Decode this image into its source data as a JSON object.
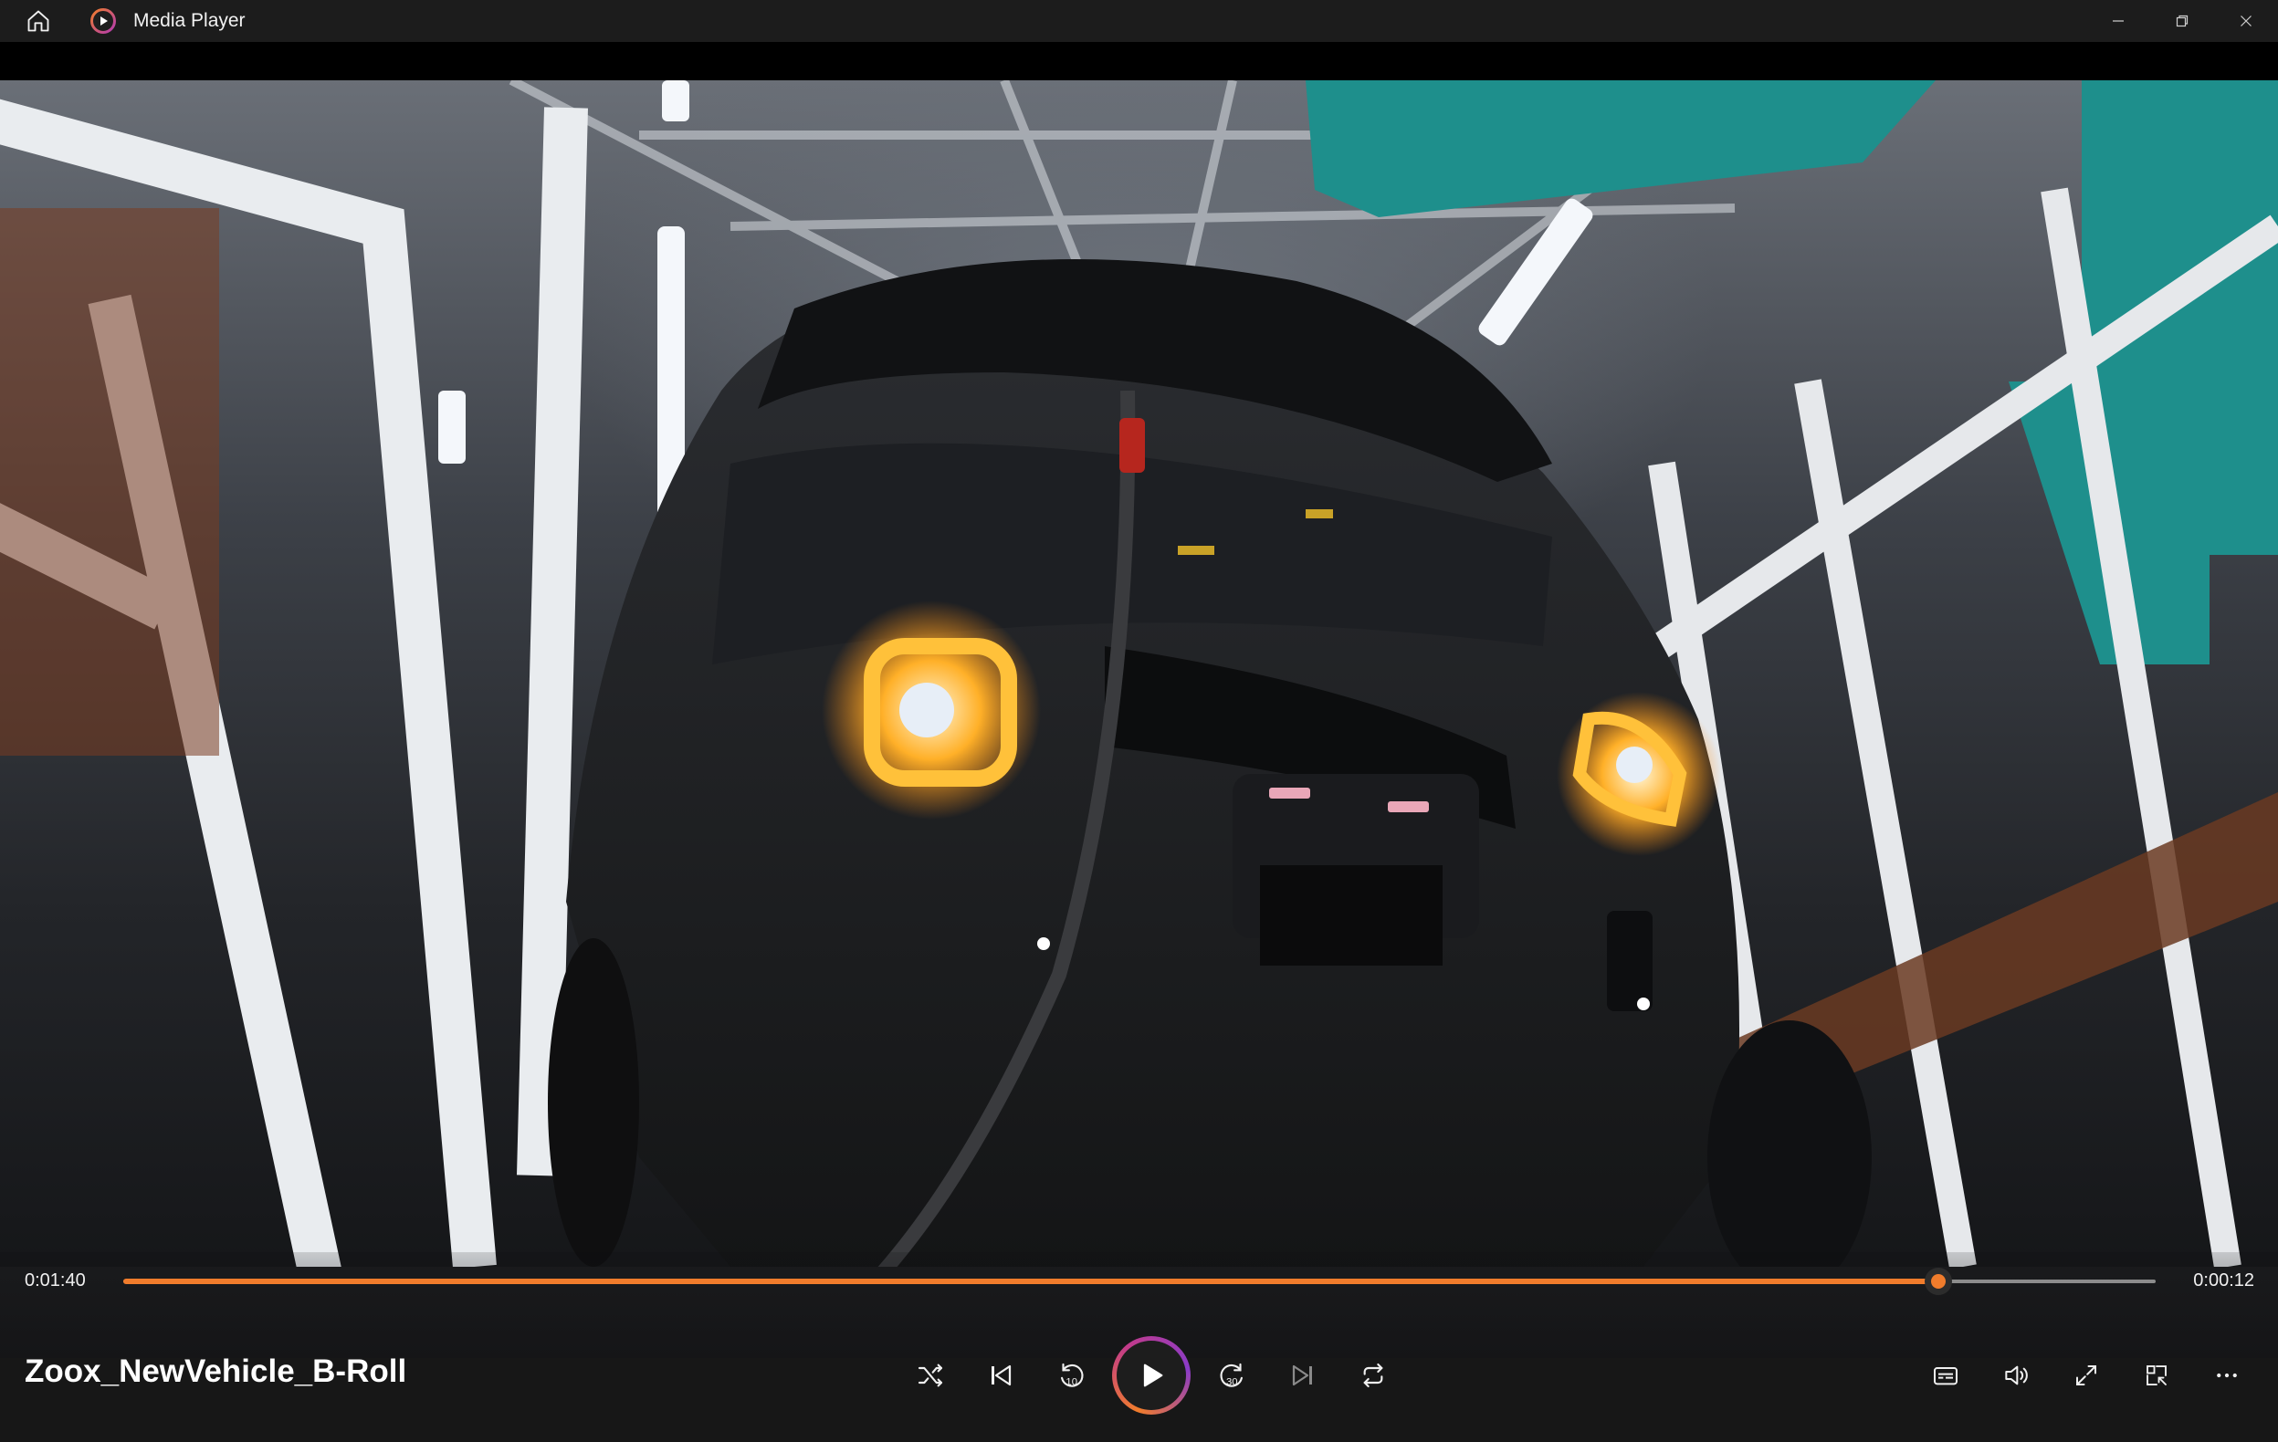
{
  "window": {
    "title": "Media Player",
    "icons": {
      "home": "home-icon",
      "app": "media-player-app-icon",
      "minimize": "minimize-icon",
      "restore": "restore-icon",
      "close": "close-icon"
    }
  },
  "media": {
    "title": "Zoox_NewVehicle_B-Roll"
  },
  "playback": {
    "elapsed": "0:01:40",
    "remaining": "0:00:12",
    "progress": 0.893,
    "state": "paused"
  },
  "controls": {
    "transport": [
      {
        "name": "shuffle",
        "icon": "shuffle-icon"
      },
      {
        "name": "previous",
        "icon": "previous-track-icon"
      },
      {
        "name": "skip-back",
        "icon": "skip-back-10-icon",
        "label": "10"
      },
      {
        "name": "play",
        "icon": "play-icon"
      },
      {
        "name": "skip-forward",
        "icon": "skip-forward-30-icon",
        "label": "30"
      },
      {
        "name": "next",
        "icon": "next-track-icon"
      },
      {
        "name": "repeat",
        "icon": "repeat-icon"
      }
    ],
    "tools": [
      {
        "name": "captions",
        "icon": "captions-icon"
      },
      {
        "name": "volume",
        "icon": "volume-icon"
      },
      {
        "name": "fullscreen",
        "icon": "fullscreen-icon"
      },
      {
        "name": "mini-player",
        "icon": "mini-player-icon"
      },
      {
        "name": "more",
        "icon": "more-options-icon"
      }
    ]
  },
  "colors": {
    "accent": "#f07c2c",
    "titlebar": "#1c1c1c",
    "controls_bg": "#171717",
    "track": "#8c8c8c"
  }
}
